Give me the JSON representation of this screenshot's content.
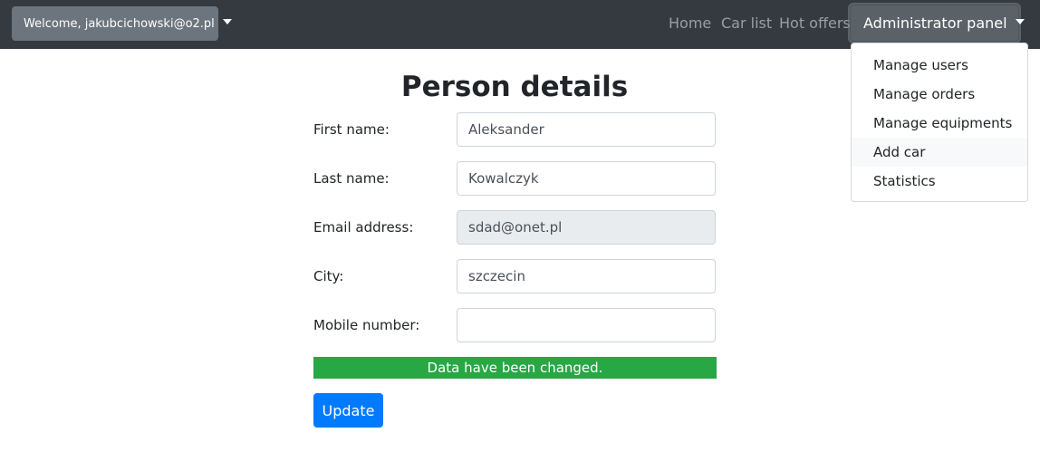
{
  "navbar": {
    "welcome_label": "Welcome, jakubcichowski@o2.pl",
    "links": [
      "Home",
      "Car list",
      "Hot offers"
    ],
    "admin_label": "Administrator panel",
    "admin_menu": [
      "Manage users",
      "Manage orders",
      "Manage equipments",
      "Add car",
      "Statistics"
    ]
  },
  "page": {
    "title": "Person details"
  },
  "form": {
    "first_name_label": "First name:",
    "first_name_value": "Aleksander",
    "last_name_label": "Last name:",
    "last_name_value": "Kowalczyk",
    "email_label": "Email address:",
    "email_value": "sdad@onet.pl",
    "city_label": "City:",
    "city_value": "szczecin",
    "mobile_label": "Mobile number:",
    "mobile_value": ""
  },
  "status": {
    "message": "Data have been changed."
  },
  "actions": {
    "update_label": "Update"
  },
  "colors": {
    "navbar": "#343a40",
    "success": "#28a745",
    "primary": "#007bff",
    "secondary": "#6c757d"
  }
}
